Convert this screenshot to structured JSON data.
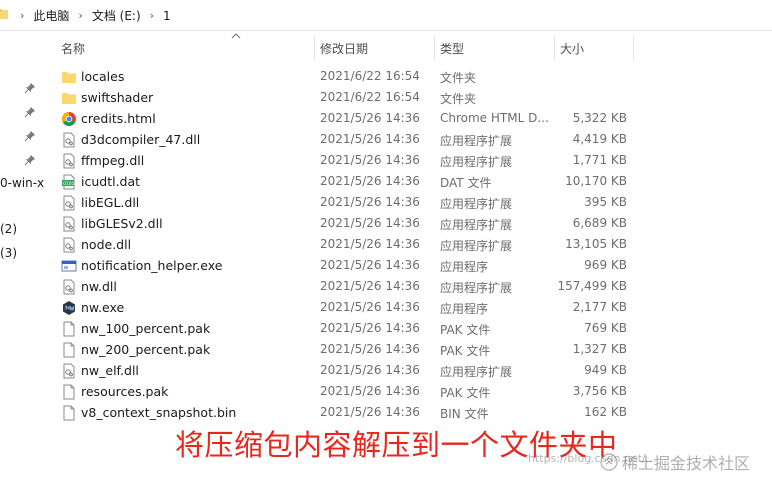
{
  "address_bar": {
    "crumbs": [
      "此电脑",
      "文档 (E:)",
      "1"
    ]
  },
  "nav_pane": {
    "items": [
      "0-win-x",
      "(2)",
      "(3)"
    ]
  },
  "columns": {
    "name": "名称",
    "date": "修改日期",
    "type": "类型",
    "size": "大小"
  },
  "files": [
    {
      "name": "locales",
      "date": "2021/6/22 16:54",
      "type": "文件夹",
      "size": "",
      "icon": "folder-icon"
    },
    {
      "name": "swiftshader",
      "date": "2021/6/22 16:54",
      "type": "文件夹",
      "size": "",
      "icon": "folder-icon"
    },
    {
      "name": "credits.html",
      "date": "2021/5/26 14:36",
      "type": "Chrome HTML D...",
      "size": "5,322 KB",
      "icon": "chrome-html-icon"
    },
    {
      "name": "d3dcompiler_47.dll",
      "date": "2021/5/26 14:36",
      "type": "应用程序扩展",
      "size": "4,419 KB",
      "icon": "dll-icon"
    },
    {
      "name": "ffmpeg.dll",
      "date": "2021/5/26 14:36",
      "type": "应用程序扩展",
      "size": "1,771 KB",
      "icon": "dll-icon"
    },
    {
      "name": "icudtl.dat",
      "date": "2021/5/26 14:36",
      "type": "DAT 文件",
      "size": "10,170 KB",
      "icon": "dat-icon"
    },
    {
      "name": "libEGL.dll",
      "date": "2021/5/26 14:36",
      "type": "应用程序扩展",
      "size": "395 KB",
      "icon": "dll-icon"
    },
    {
      "name": "libGLESv2.dll",
      "date": "2021/5/26 14:36",
      "type": "应用程序扩展",
      "size": "6,689 KB",
      "icon": "dll-icon"
    },
    {
      "name": "node.dll",
      "date": "2021/5/26 14:36",
      "type": "应用程序扩展",
      "size": "13,105 KB",
      "icon": "dll-icon"
    },
    {
      "name": "notification_helper.exe",
      "date": "2021/5/26 14:36",
      "type": "应用程序",
      "size": "969 KB",
      "icon": "exe-window-icon"
    },
    {
      "name": "nw.dll",
      "date": "2021/5/26 14:36",
      "type": "应用程序扩展",
      "size": "157,499 KB",
      "icon": "dll-icon"
    },
    {
      "name": "nw.exe",
      "date": "2021/5/26 14:36",
      "type": "应用程序",
      "size": "2,177 KB",
      "icon": "nw-exe-icon"
    },
    {
      "name": "nw_100_percent.pak",
      "date": "2021/5/26 14:36",
      "type": "PAK 文件",
      "size": "769 KB",
      "icon": "file-icon"
    },
    {
      "name": "nw_200_percent.pak",
      "date": "2021/5/26 14:36",
      "type": "PAK 文件",
      "size": "1,327 KB",
      "icon": "file-icon"
    },
    {
      "name": "nw_elf.dll",
      "date": "2021/5/26 14:36",
      "type": "应用程序扩展",
      "size": "949 KB",
      "icon": "dll-icon"
    },
    {
      "name": "resources.pak",
      "date": "2021/5/26 14:36",
      "type": "PAK 文件",
      "size": "3,756 KB",
      "icon": "file-icon"
    },
    {
      "name": "v8_context_snapshot.bin",
      "date": "2021/5/26 14:36",
      "type": "BIN 文件",
      "size": "162 KB",
      "icon": "file-icon"
    }
  ],
  "overlay": {
    "caption": "将压缩包内容解压到一个文件夹中",
    "watermark_url": "https://blog.csdn.net/...",
    "watermark_brand": "稀土掘金技术社区"
  },
  "colors": {
    "caption": "#e8271d",
    "folder": "#f8d775",
    "header_text": "#4d4d4d",
    "secondary_text": "#6d6d6d"
  }
}
